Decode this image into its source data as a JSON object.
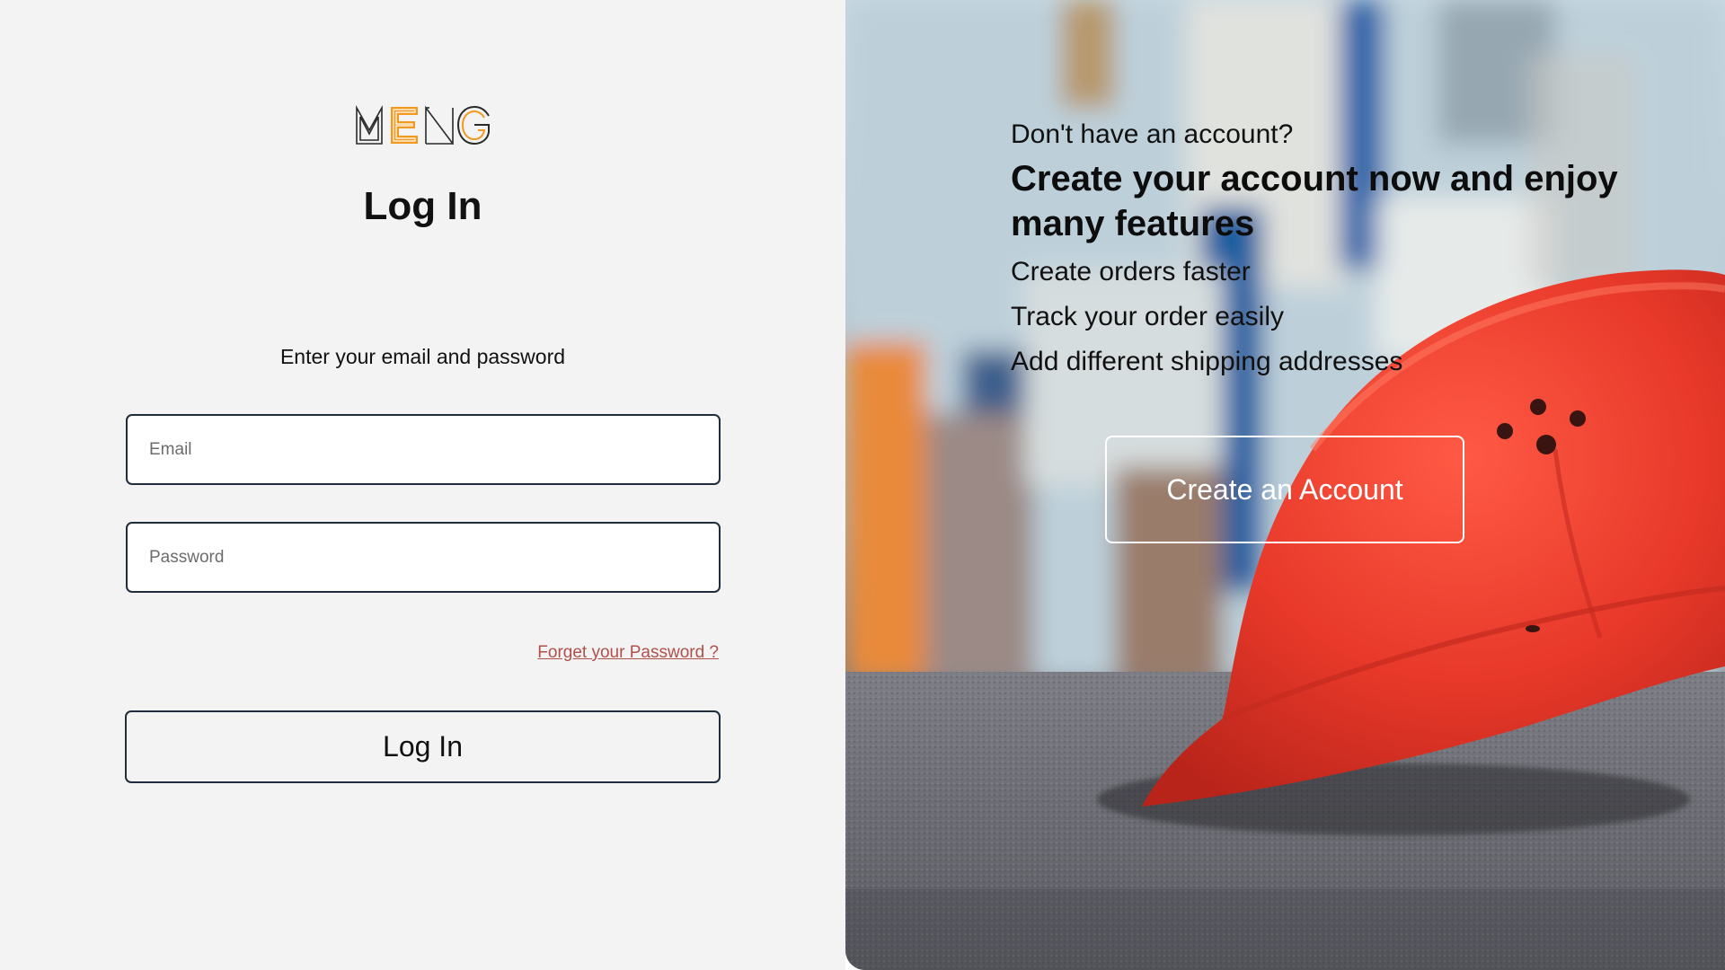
{
  "logo": {
    "text": "MENG",
    "accent_color": "#f29a1f",
    "outline_color": "#2a2a2a"
  },
  "login": {
    "title": "Log In",
    "subtitle": "Enter your email and password",
    "email_placeholder": "Email",
    "password_placeholder": "Password",
    "forgot_password": "Forget your Password ?",
    "login_button": "Log In"
  },
  "signup": {
    "question": "Don't have an account?",
    "headline": "Create your account now and enjoy many features",
    "features": [
      "Create orders faster",
      "Track your order easily",
      "Add different shipping addresses"
    ],
    "create_button": "Create an Account"
  },
  "colors": {
    "left_background": "#f3f3f3",
    "field_border": "#1f2d3d",
    "link_color": "#b0504a",
    "helmet_red": "#e8392a"
  },
  "image": {
    "icon": "red-hard-hat-on-asphalt-photo"
  }
}
